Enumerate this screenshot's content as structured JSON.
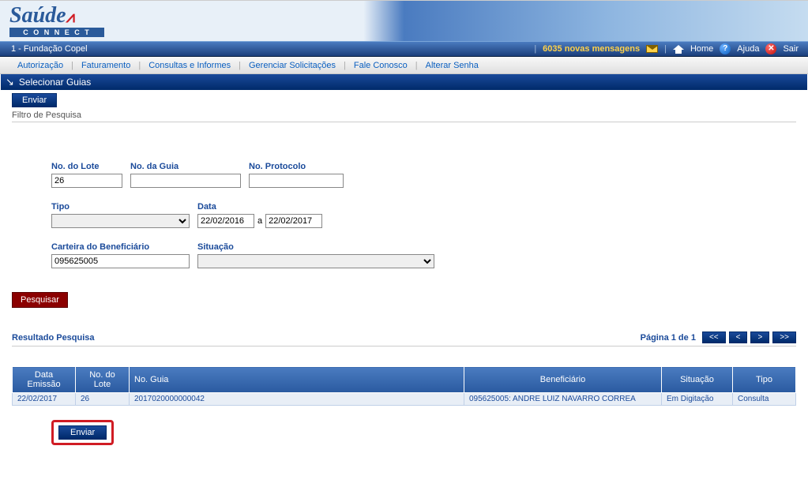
{
  "logo": {
    "top": "Saúde",
    "pulse": "∧",
    "bottom": "C O N N E C T"
  },
  "topbar": {
    "org": "1 - Fundação Copel",
    "messages_count": "6035",
    "messages_label": "novas mensagens",
    "home": "Home",
    "help": "Ajuda",
    "exit": "Sair"
  },
  "menu": {
    "items": [
      "Autorização",
      "Faturamento",
      "Consultas e Informes",
      "Gerenciar Solicitações",
      "Fale Conosco",
      "Alterar Senha"
    ]
  },
  "page": {
    "title": "Selecionar Guias"
  },
  "buttons": {
    "enviar_top": "Enviar",
    "pesquisar": "Pesquisar",
    "enviar_bottom": "Enviar"
  },
  "filter": {
    "section_title": "Filtro de Pesquisa",
    "fields": {
      "lote": {
        "label": "No. do Lote",
        "value": "26"
      },
      "guia": {
        "label": "No. da Guia",
        "value": ""
      },
      "protocolo": {
        "label": "No. Protocolo",
        "value": ""
      },
      "tipo": {
        "label": "Tipo",
        "value": ""
      },
      "data": {
        "label": "Data",
        "from": "22/02/2016",
        "to": "22/02/2017",
        "sep": "a"
      },
      "carteira": {
        "label": "Carteira do Beneficiário",
        "value": "095625005"
      },
      "situacao": {
        "label": "Situação",
        "value": ""
      }
    }
  },
  "results": {
    "title": "Resultado Pesquisa",
    "pager": {
      "info": "Página 1 de 1",
      "first": "<<",
      "prev": "<",
      "next": ">",
      "last": ">>"
    },
    "columns": [
      "Data Emissão",
      "No. do Lote",
      "No. Guia",
      "Beneficiário",
      "Situação",
      "Tipo"
    ],
    "rows": [
      {
        "data_emissao": "22/02/2017",
        "lote": "26",
        "guia": "2017020000000042",
        "beneficiario": "095625005: ANDRE LUIZ NAVARRO CORREA",
        "situacao": "Em Digitação",
        "tipo": "Consulta"
      }
    ]
  }
}
